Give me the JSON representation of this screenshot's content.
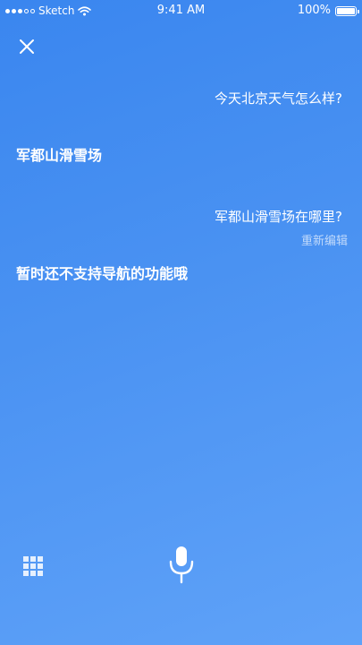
{
  "status_bar": {
    "carrier": "Sketch",
    "time": "9:41 AM",
    "battery_text": "100%",
    "battery_level": 1.0,
    "signal_bars_filled": 3,
    "signal_bars_total": 5
  },
  "header": {
    "close_icon": "close-icon"
  },
  "conversation": {
    "messages": [
      {
        "role": "user",
        "text": "今天北京天气怎么样?"
      },
      {
        "role": "assistant",
        "text": "军都山滑雪场"
      },
      {
        "role": "user",
        "text": "军都山滑雪场在哪里?"
      },
      {
        "role": "assistant",
        "text": "暂时还不支持导航的功能哦"
      }
    ],
    "edit_label": "重新编辑"
  },
  "bottom_bar": {
    "keyboard_icon": "keyboard-grid-icon",
    "mic_icon": "microphone-icon"
  },
  "colors": {
    "background_start": "#3a86ef",
    "background_end": "#5fa2f8",
    "text": "#ffffff"
  }
}
